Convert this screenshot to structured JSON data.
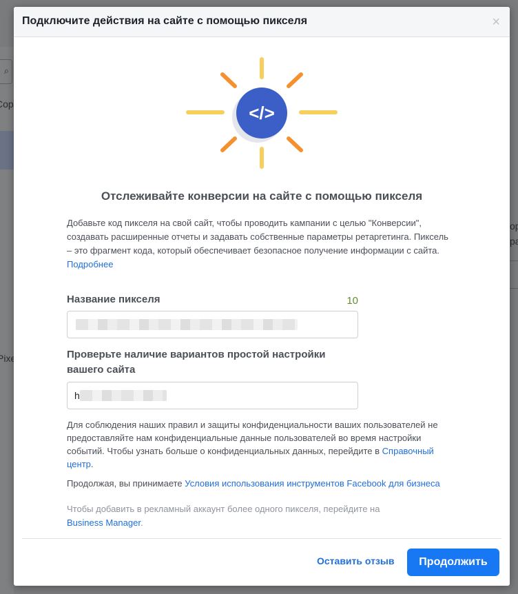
{
  "background": {
    "fragments": [
      "Cop",
      "Pixe",
      "ор",
      "ра"
    ]
  },
  "modal": {
    "title": "Подключите действия на сайте с помощью пикселя",
    "close_glyph": "×",
    "illustration_icon": "code-brackets-icon",
    "code_glyph": "</>",
    "heading": "Отслеживайте конверсии на сайте с помощью пикселя",
    "description": "Добавьте код пикселя на свой сайт, чтобы проводить кампании с целью \"Конверсии\", создавать расширенные отчеты и задавать собственные параметры ретаргетинга. Пиксель – это фрагмент кода, который обеспечивает безопасное получение информации с сайта.",
    "learn_more_link": "Подробнее",
    "pixel_name_label": "Название пикселя",
    "pixel_name_counter": "10",
    "site_check_label": "Проверьте наличие вариантов простой настройки вашего сайта",
    "site_input_prefix": "h",
    "privacy_text": "Для соблюдения наших правил и защиты конфиденциальности ваших пользователей не предоставляйте нам конфиденциальные данные пользователей во время настройки событий. Чтобы узнать больше о конфиденциальных данных, перейдите в",
    "privacy_link": "Справочный центр",
    "privacy_end": ".",
    "terms_prefix": "Продолжая, вы принимаете",
    "terms_link": "Условия использования инструментов Facebook для бизнеса",
    "multi_pixel_text": "Чтобы добавить в рекламный аккаунт более одного пикселя, перейдите на",
    "business_manager_link": "Business Manager",
    "business_manager_end": ".",
    "feedback_button": "Оставить отзыв",
    "continue_button": "Продолжить"
  },
  "colors": {
    "accent": "#1877f2",
    "link": "#216fdb",
    "icon_circle": "#3b5ec7",
    "ray_orange": "#f5902f",
    "ray_yellow": "#f7cf5c",
    "counter_green": "#5d8f2f"
  }
}
